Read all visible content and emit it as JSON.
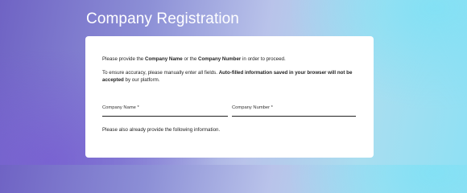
{
  "page": {
    "title": "Company Registration"
  },
  "intro": {
    "p1_a": "Please provide the ",
    "p1_b": "Company Name",
    "p1_c": " or the ",
    "p1_d": "Company Number",
    "p1_e": " in order to proceed.",
    "p2_a": "To ensure accuracy, please manually enter all fields. ",
    "p2_b": "Auto-filled information saved in your browser will not be accepted",
    "p2_c": " by our platform."
  },
  "fields": {
    "company_name": {
      "label": "Company Name *",
      "value": ""
    },
    "company_number": {
      "label": "Company Number *",
      "value": ""
    }
  },
  "footer_note": "Please also already provide the following information.",
  "colors": {
    "card_background": "#ffffff",
    "title_text": "#ffffff",
    "field_underline": "#222222"
  }
}
